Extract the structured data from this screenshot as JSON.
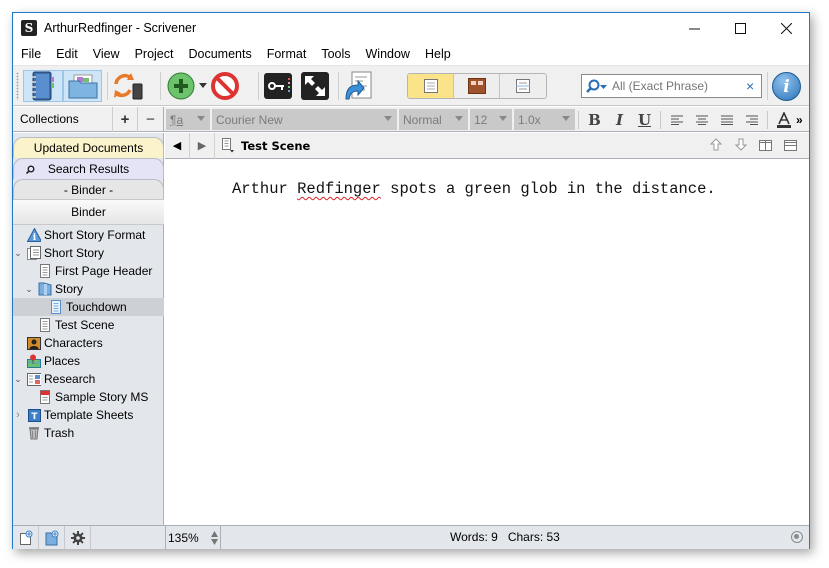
{
  "window": {
    "title": "ArthurRedfinger - Scrivener",
    "minimize_icon": "minimize-icon",
    "maximize_icon": "maximize-icon",
    "close_icon": "close-icon"
  },
  "menu": [
    "File",
    "Edit",
    "View",
    "Project",
    "Documents",
    "Format",
    "Tools",
    "Window",
    "Help"
  ],
  "toolbar": {
    "buttons": [
      "binder-toggle",
      "collections-toggle",
      "sync",
      "add",
      "add-dropdown",
      "delete",
      "keywords",
      "full-screen",
      "compile"
    ],
    "view_modes": [
      "scrivenings",
      "corkboard",
      "outliner"
    ],
    "active_view_mode": "scrivenings",
    "search_placeholder": "All (Exact Phrase)",
    "clear_search": "×",
    "info_label": "i"
  },
  "collections": {
    "label": "Collections",
    "add": "+",
    "remove": "−",
    "tabs": [
      "Updated Documents",
      "Search Results",
      "- Binder -"
    ],
    "colors": {
      "updated": "#fbf3cc",
      "search": "#e4e4f6",
      "binder": "#e6e6e6"
    }
  },
  "format_bar": {
    "style_icon": "¶a",
    "font": "Courier New",
    "style": "Normal",
    "size": "12",
    "line_spacing": "1.0x",
    "bold": "B",
    "italic": "I",
    "underline": "U",
    "more": "»"
  },
  "binder": {
    "header": "Binder",
    "items": [
      {
        "label": "Short Story Format",
        "icon": "info-triangle-icon",
        "depth": 0,
        "twisty": ""
      },
      {
        "label": "Short Story",
        "icon": "draft-folder-icon",
        "depth": 0,
        "twisty": "expanded"
      },
      {
        "label": "First Page Header",
        "icon": "text-document-icon",
        "depth": 1,
        "twisty": ""
      },
      {
        "label": "Story",
        "icon": "folder-icon",
        "depth": 1,
        "twisty": "expanded"
      },
      {
        "label": "Touchdown",
        "icon": "text-document-icon",
        "depth": 2,
        "twisty": "",
        "selected": true
      },
      {
        "label": "Test Scene",
        "icon": "text-document-icon",
        "depth": 1,
        "twisty": ""
      },
      {
        "label": "Characters",
        "icon": "character-icon",
        "depth": 0,
        "twisty": ""
      },
      {
        "label": "Places",
        "icon": "map-pin-icon",
        "depth": 0,
        "twisty": ""
      },
      {
        "label": "Research",
        "icon": "research-folder-icon",
        "depth": 0,
        "twisty": "expanded"
      },
      {
        "label": "Sample Story MS",
        "icon": "pdf-icon",
        "depth": 1,
        "twisty": ""
      },
      {
        "label": "Template Sheets",
        "icon": "template-icon",
        "depth": 0,
        "twisty": "collapsed"
      },
      {
        "label": "Trash",
        "icon": "trash-icon",
        "depth": 0,
        "twisty": ""
      }
    ]
  },
  "editor": {
    "back": "◀",
    "forward": "▶",
    "doc_title": "Test Scene",
    "text_before": "Arthur ",
    "text_misspelled": "Redfinger",
    "text_after": " spots a green glob in the distance."
  },
  "footer": {
    "zoom": "135%",
    "words_label": "Words: 9",
    "chars_label": "Chars: 53"
  }
}
